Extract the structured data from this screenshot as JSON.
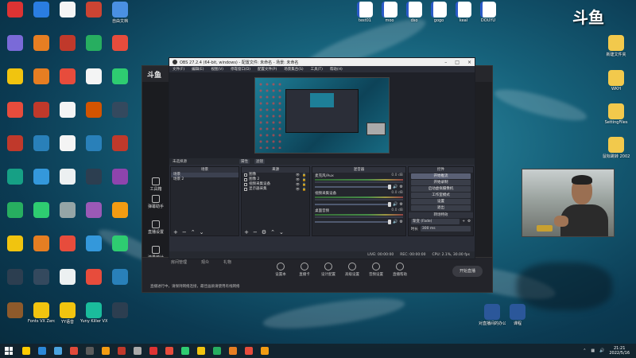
{
  "brand": {
    "logo": "斗鱼"
  },
  "desktop_left": [
    {
      "label": "",
      "color": "#d33"
    },
    {
      "label": "",
      "color": "#2a7de1"
    },
    {
      "label": "",
      "color": "#f4f4f4"
    },
    {
      "label": "",
      "color": "#c43"
    },
    {
      "label": "自由文档",
      "color": "#4a90e2"
    },
    {
      "label": "",
      "color": "#7a6ad8"
    },
    {
      "label": "",
      "color": "#e67e22"
    },
    {
      "label": "",
      "color": "#c0392b"
    },
    {
      "label": "",
      "color": "#27ae60"
    },
    {
      "label": "",
      "color": "#e74c3c"
    },
    {
      "label": "",
      "color": "#f1c40f"
    },
    {
      "label": "",
      "color": "#e67e22"
    },
    {
      "label": "",
      "color": "#e74c3c"
    },
    {
      "label": "",
      "color": "#f4f4f4"
    },
    {
      "label": "",
      "color": "#2ecc71"
    },
    {
      "label": "",
      "color": "#e74c3c"
    },
    {
      "label": "",
      "color": "#c0392b"
    },
    {
      "label": "",
      "color": "#f4f4f4"
    },
    {
      "label": "",
      "color": "#d35400"
    },
    {
      "label": "",
      "color": "#34495e"
    },
    {
      "label": "",
      "color": "#c0392b"
    },
    {
      "label": "",
      "color": "#2980b9"
    },
    {
      "label": "",
      "color": "#f4f4f4"
    },
    {
      "label": "",
      "color": "#2980b9"
    },
    {
      "label": "",
      "color": "#c0392b"
    },
    {
      "label": "",
      "color": "#16a085"
    },
    {
      "label": "",
      "color": "#3498db"
    },
    {
      "label": "",
      "color": "#ecf0f1"
    },
    {
      "label": "",
      "color": "#2c3e50"
    },
    {
      "label": "",
      "color": "#8e44ad"
    },
    {
      "label": "",
      "color": "#27ae60"
    },
    {
      "label": "",
      "color": "#2ecc71"
    },
    {
      "label": "",
      "color": "#95a5a6"
    },
    {
      "label": "",
      "color": "#9b59b6"
    },
    {
      "label": "",
      "color": "#f39c12"
    },
    {
      "label": "",
      "color": "#f1c40f"
    },
    {
      "label": "",
      "color": "#e67e22"
    },
    {
      "label": "",
      "color": "#e74c3c"
    },
    {
      "label": "",
      "color": "#3498db"
    },
    {
      "label": "",
      "color": "#2ecc71"
    },
    {
      "label": "",
      "color": "#2c3e50"
    },
    {
      "label": "",
      "color": "#34495e"
    },
    {
      "label": "",
      "color": "#ecf0f1"
    },
    {
      "label": "",
      "color": "#e74c3c"
    },
    {
      "label": "",
      "color": "#2980b9"
    },
    {
      "label": "",
      "color": "#8e5a2b"
    },
    {
      "label": "Fonts VX ZeroJudi",
      "color": "#f1c40f"
    },
    {
      "label": "YY语音",
      "color": "#f1c40f"
    },
    {
      "label": "Yuny Killer VX",
      "color": "#1abc9c"
    },
    {
      "label": "",
      "color": "#2c3e50"
    }
  ],
  "desktop_top": [
    {
      "label": "test01",
      "color": "#2a5ac8"
    },
    {
      "label": "moo",
      "color": "#2a5ac8"
    },
    {
      "label": "dso",
      "color": "#2a5ac8"
    },
    {
      "label": "gogo",
      "color": "#2a5ac8"
    },
    {
      "label": "keal",
      "color": "#2a5ac8"
    },
    {
      "label": "DOUYU",
      "color": "#2a5ac8"
    }
  ],
  "desktop_right": [
    {
      "label": "新建文件夹",
      "color": "#f2c94c"
    },
    {
      "label": "WKH",
      "color": "#f2c94c"
    },
    {
      "label": "SettingFiles",
      "color": "#f2c94c"
    },
    {
      "label": "鼠标跳转 2002",
      "color": "#f2c94c"
    }
  ],
  "desktop_docs": [
    {
      "label": "对直播间的办公",
      "color": "#2b579a"
    },
    {
      "label": "课程",
      "color": "#2b579a"
    }
  ],
  "douyu": {
    "logo": "斗鱼",
    "side_items": [
      "工具箱",
      "弹幕助手",
      "直播设置",
      "流量统计"
    ],
    "bottom_tabs": [
      "房间管理",
      "观众",
      "礼物"
    ],
    "tools": [
      "设置本",
      "直播卡",
      "设计配置",
      "高级设置",
      "音频设置",
      "直播帮助"
    ],
    "start_label": "开始直播",
    "bottom_msg": "直播进行中，请保持网络连接，最佳画质请使用有线网络"
  },
  "obs": {
    "title": "OBS 27.2.4 (64-bit, windows) - 配置文件: 未命名 - 场景: 未命名",
    "menu": [
      "文件(F)",
      "编辑(E)",
      "视图(V)",
      "停靠窗口(D)",
      "配置文件(P)",
      "场景集合(S)",
      "工具(T)",
      "帮助(H)"
    ],
    "context_bar": {
      "label": "未选择源",
      "props": "属性",
      "filters": "滤镜"
    },
    "docks": {
      "scenes_title": "场景",
      "scenes": [
        "场景",
        "场景 2"
      ],
      "sources_title": "来源",
      "sources": [
        "图像",
        "图像 2",
        "视频采集设备",
        "显示器采集"
      ],
      "mixer_title": "混音器",
      "mixer": [
        {
          "name": "麦克风/Aux",
          "db": "0.0 dB"
        },
        {
          "name": "视频采集设备",
          "db": "0.0 dB"
        },
        {
          "name": "桌面音频",
          "db": "0.0 dB"
        }
      ],
      "controls_title": "控件",
      "controls": [
        "开始推流",
        "开始录制",
        "启动虚拟摄像机",
        "工作室模式",
        "设置",
        "退出"
      ],
      "transitions_title": "转场特效",
      "transition": "渐变 (Fade)",
      "duration_label": "时长",
      "duration": "300 ms"
    },
    "status": {
      "live": "LIVE: 00:00:00",
      "rec": "REC: 00:00:00",
      "cpu": "CPU: 2.1%, 30.00 fps"
    }
  },
  "taskbar": {
    "icons": [
      "#ffcc00",
      "#2b88d8",
      "#4aa3df",
      "#e04a3a",
      "#5b5b5b",
      "#f39c12",
      "#c0392b",
      "#aaaaaa",
      "#d33",
      "#e74c3c",
      "#2ecc71",
      "#f1c40f",
      "#27ae60",
      "#e67e22",
      "#e74c3c",
      "#f39c12"
    ],
    "time": "21:21",
    "date": "2022/5/16"
  }
}
